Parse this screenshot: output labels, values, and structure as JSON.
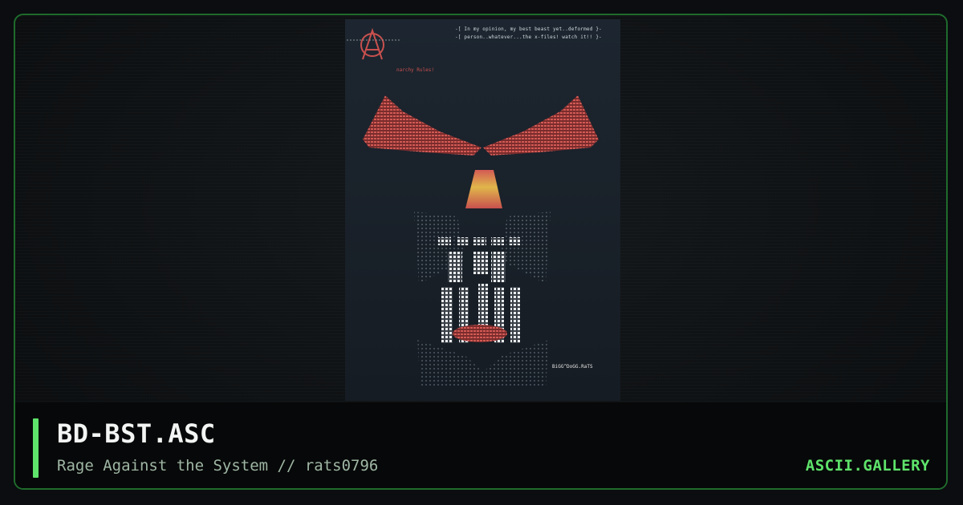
{
  "artwork": {
    "header_lines": [
      "-[ In my opinion, my best beast yet..deformed }-",
      "-[ person..whatever...the x-files! watch it!! }-"
    ],
    "group_tag": "narchy Rules!",
    "signature": "BiGG^DoGG.RaTS"
  },
  "footer": {
    "title": "BD-BST.ASC",
    "subtitle": "Rage Against the System // rats0796",
    "brand": "ASCII.GALLERY"
  },
  "colors": {
    "accent": "#5ee36b",
    "frame_border": "#1f6b2c",
    "art_red": "#c8504e",
    "art_yellow": "#e0b64a",
    "art_white": "#e8e8e8"
  }
}
